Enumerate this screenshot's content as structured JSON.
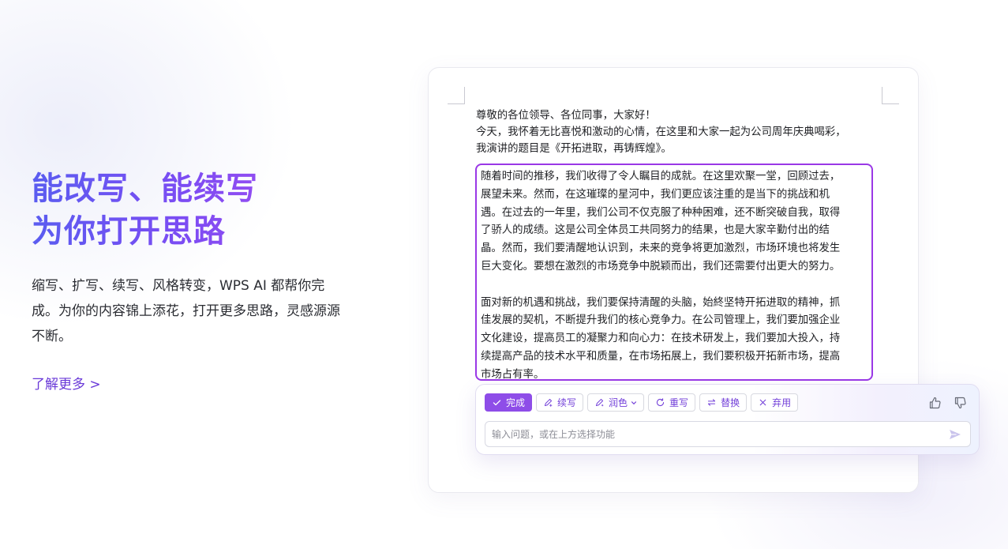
{
  "hero": {
    "title_line1": "能改写、能续写",
    "title_line2": "为你打开思路",
    "description": "缩写、扩写、续写、风格转变，WPS AI 都帮你完成。为你的内容锦上添花，打开更多思路，灵感源源不断。",
    "learn_more": "了解更多 >"
  },
  "document": {
    "lines": [
      "尊敬的各位领导、各位同事，大家好！",
      "今天，我怀着无比喜悦和激动的心情，在这里和大家一起为公司周年庆典喝彩，",
      "我演讲的题目是《开拓进取，再铸辉煌》。"
    ],
    "selected_paragraph1": [
      "随着时间的推移，我们收得了令人瞩目的成就。在这里欢聚一堂，回顾过去，",
      "展望未来。然而，在这璀璨的星河中，我们更应该注重的是当下的挑战和机",
      "遇。在过去的一年里，我们公司不仅克服了种种困难，还不断突破自我，取得",
      "了骄人的成绩。这是公司全体员工共同努力的结果，也是大家辛勤付出的结",
      "晶。然而，我们要清醒地认识到，未来的竞争将更加激烈，市场环境也将发生",
      "巨大变化。要想在激烈的市场竞争中脱颖而出，我们还需要付出更大的努力。"
    ],
    "selected_paragraph2": [
      "面对新的机遇和挑战，我们要保持清醒的头脑，始終坚特开拓进取的精神，抓",
      "佳发展的契机，不断提升我们的核心竞争力。在公司管理上，我们要加强企业",
      "文化建设，提高员工的凝聚力和向心力：在技术研发上，我们要加大投入，持",
      "续提高产品的技术水平和质量，在市场拓展上，我们要积极开拓新市场，提高",
      "市场占有率。"
    ]
  },
  "ai_toolbar": {
    "done": "完成",
    "continue": "续写",
    "polish": "润色",
    "rewrite": "重写",
    "replace": "替换",
    "discard": "弃用"
  },
  "ai_input": {
    "placeholder": "输入问题，或在上方选择功能"
  },
  "icons": {
    "done": "check-icon",
    "continue": "pen-sparkle-icon",
    "polish": "brush-sparkle-icon",
    "rewrite": "refresh-icon",
    "replace": "swap-icon",
    "discard": "close-icon",
    "like": "thumbs-up-icon",
    "dislike": "thumbs-down-icon",
    "send": "send-icon"
  },
  "colors": {
    "accent": "#8e4de8",
    "title_gradient_start": "#5a5cf0",
    "title_gradient_end": "#b04ef0",
    "selection_border": "#9a38e6",
    "link": "#6a3ad8"
  }
}
